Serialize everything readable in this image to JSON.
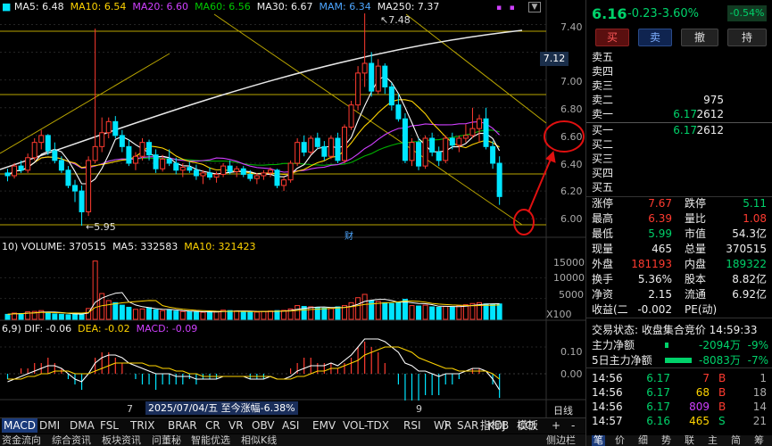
{
  "main_legend": {
    "ma5": "MA5: 6.48",
    "ma10": "MA10: 6.54",
    "ma20": "MA20: 6.60",
    "ma60": "MA60: 6.56",
    "ma30": "MA30: 6.67",
    "mam": "MAM: 6.34",
    "ma250": "MA250: 7.37"
  },
  "price_axis": [
    "7.40",
    "7.20",
    "7.00",
    "6.80",
    "6.60",
    "6.40",
    "6.20",
    "6.00"
  ],
  "current_price_tag": "7.12",
  "high_mark": "7.48",
  "low_mark": "5.95",
  "cai_tag": "财",
  "volume_legend": {
    "prefix": "10)",
    "volume": "VOLUME: 370515",
    "ma5": "MA5: 332583",
    "ma10": "MA10: 321423"
  },
  "volume_axis": [
    "15000",
    "10000",
    "5000"
  ],
  "volume_unit": "X100",
  "macd_legend": {
    "prefix": "6,9)",
    "dif": "DIF: -0.06",
    "dea": "DEA: -0.02",
    "macd": "MACD: -0.09"
  },
  "macd_axis": [
    "0.10",
    "0.00"
  ],
  "x_labels": {
    "m7": "7",
    "m9": "9",
    "date_info": "2025/07/04/五  至今涨幅-6.38%",
    "period": "日线"
  },
  "indicator_tabs": [
    "MACD",
    "DMI",
    "DMA",
    "FSL",
    "TRIX",
    "BRAR",
    "CR",
    "VR",
    "OBV",
    "ASI",
    "EMV",
    "VOL-TDX",
    "RSI",
    "WR",
    "SAR",
    "KDJ",
    "CCI"
  ],
  "indicator_right": {
    "more": "〉",
    "indicator_b": "指标B",
    "template": "模板",
    "plus": "+",
    "minus": "-"
  },
  "bottom_tabs": [
    "资金流向",
    "综合资讯",
    "板块资讯",
    "问董秘",
    "智能优选",
    "相似K线"
  ],
  "bottom_right": "侧边栏",
  "quote": {
    "price": "6.16",
    "change": "-0.23",
    "pct": "-3.60%",
    "badge": "-0.54%"
  },
  "buttons": {
    "buy": "买",
    "sell": "卖",
    "cancel": "撤",
    "hold": "持"
  },
  "book_sell": [
    {
      "label": "卖五",
      "price": "",
      "vol": ""
    },
    {
      "label": "卖四",
      "price": "",
      "vol": ""
    },
    {
      "label": "卖三",
      "price": "",
      "vol": ""
    },
    {
      "label": "卖二",
      "price": "",
      "vol": "975"
    },
    {
      "label": "卖一",
      "price": "6.17",
      "vol": "2612"
    }
  ],
  "book_buy": [
    {
      "label": "买一",
      "price": "6.17",
      "vol": "2612"
    },
    {
      "label": "买二",
      "price": "",
      "vol": ""
    },
    {
      "label": "买三",
      "price": "",
      "vol": ""
    },
    {
      "label": "买四",
      "price": "",
      "vol": ""
    },
    {
      "label": "买五",
      "price": "",
      "vol": ""
    }
  ],
  "stats": [
    {
      "l1": "涨停",
      "v1": "7.67",
      "c1": "red",
      "l2": "跌停",
      "v2": "5.11",
      "c2": "green"
    },
    {
      "l1": "最高",
      "v1": "6.39",
      "c1": "red",
      "l2": "量比",
      "v2": "1.08",
      "c2": "red"
    },
    {
      "l1": "最低",
      "v1": "5.99",
      "c1": "green",
      "l2": "市值",
      "v2": "54.3亿",
      "c2": "white"
    },
    {
      "l1": "现量",
      "v1": "465",
      "c1": "white",
      "l2": "总量",
      "v2": "370515",
      "c2": "white"
    },
    {
      "l1": "外盘",
      "v1": "181193",
      "c1": "red",
      "l2": "内盘",
      "v2": "189322",
      "c2": "green"
    },
    {
      "l1": "换手",
      "v1": "5.36%",
      "c1": "white",
      "l2": "股本",
      "v2": "8.82亿",
      "c2": "white"
    },
    {
      "l1": "净资",
      "v1": "2.15",
      "c1": "white",
      "l2": "流通",
      "v2": "6.92亿",
      "c2": "white"
    },
    {
      "l1": "收益(二",
      "v1": "-0.002",
      "c1": "white",
      "l2": "PE(动)",
      "v2": "",
      "c2": "white"
    }
  ],
  "trade_status": "交易状态: 收盘集合竞价 14:59:33",
  "flows": [
    {
      "label": "主力净额",
      "value": "-2094万",
      "pct": "-9%"
    },
    {
      "label": "5日主力净额",
      "value": "-8083万",
      "pct": "-7%"
    }
  ],
  "ticks": [
    {
      "time": "14:56",
      "price": "6.17",
      "vol": "7",
      "bs": "B",
      "n": "1",
      "vc": "red",
      "bc": "red"
    },
    {
      "time": "14:56",
      "price": "6.17",
      "vol": "68",
      "bs": "B",
      "n": "18",
      "vc": "yellow",
      "bc": "red"
    },
    {
      "time": "14:56",
      "price": "6.17",
      "vol": "809",
      "bs": "B",
      "n": "14",
      "vc": "purple",
      "bc": "red"
    },
    {
      "time": "14:57",
      "price": "6.16",
      "vol": "465",
      "bs": "S",
      "n": "21",
      "vc": "yellow",
      "bc": "green"
    }
  ],
  "right_bottom_tabs": [
    "笔",
    "价",
    "细",
    "势",
    "联",
    "主",
    "简",
    "筹"
  ],
  "colors": {
    "up": "#ff3b30",
    "down": "#00e5ff",
    "ma5": "#ffffff",
    "ma10": "#ffd400",
    "ma20": "#d040ff",
    "ma60": "#00c800",
    "annot": "#e01010"
  },
  "chart_data": {
    "type": "candlestick",
    "y_range": [
      5.93,
      7.48
    ],
    "candles": [
      [
        6.33,
        6.36,
        6.27,
        6.31
      ],
      [
        6.31,
        6.4,
        6.29,
        6.38
      ],
      [
        6.38,
        6.42,
        6.33,
        6.35
      ],
      [
        6.35,
        6.47,
        6.33,
        6.44
      ],
      [
        6.44,
        6.58,
        6.42,
        6.55
      ],
      [
        6.55,
        6.64,
        6.5,
        6.6
      ],
      [
        6.6,
        6.61,
        6.46,
        6.49
      ],
      [
        6.49,
        6.55,
        6.4,
        6.42
      ],
      [
        6.42,
        6.45,
        6.33,
        6.35
      ],
      [
        6.35,
        6.38,
        6.22,
        6.24
      ],
      [
        6.24,
        6.28,
        6.12,
        6.2
      ],
      [
        6.2,
        6.24,
        5.95,
        6.05
      ],
      [
        6.05,
        6.45,
        6.02,
        6.42
      ],
      [
        6.42,
        7.37,
        6.4,
        6.52
      ],
      [
        6.52,
        6.73,
        6.48,
        6.62
      ],
      [
        6.62,
        6.73,
        6.58,
        6.7
      ],
      [
        6.7,
        6.74,
        6.58,
        6.6
      ],
      [
        6.6,
        6.64,
        6.48,
        6.52
      ],
      [
        6.52,
        6.57,
        6.38,
        6.4
      ],
      [
        6.4,
        6.48,
        6.35,
        6.45
      ],
      [
        6.45,
        6.58,
        6.42,
        6.55
      ],
      [
        6.55,
        6.57,
        6.42,
        6.46
      ],
      [
        6.46,
        6.5,
        6.33,
        6.36
      ],
      [
        6.36,
        6.46,
        6.34,
        6.43
      ],
      [
        6.43,
        6.5,
        6.38,
        6.4
      ],
      [
        6.4,
        6.44,
        6.32,
        6.35
      ],
      [
        6.35,
        6.4,
        6.3,
        6.37
      ],
      [
        6.37,
        6.41,
        6.33,
        6.35
      ],
      [
        6.35,
        6.39,
        6.28,
        6.31
      ],
      [
        6.31,
        6.35,
        6.25,
        6.33
      ],
      [
        6.33,
        6.37,
        6.28,
        6.3
      ],
      [
        6.3,
        6.34,
        6.26,
        6.32
      ],
      [
        6.32,
        6.4,
        6.3,
        6.38
      ],
      [
        6.38,
        6.42,
        6.32,
        6.34
      ],
      [
        6.34,
        6.38,
        6.3,
        6.36
      ],
      [
        6.36,
        6.38,
        6.3,
        6.32
      ],
      [
        6.32,
        6.35,
        6.27,
        6.29
      ],
      [
        6.29,
        6.33,
        6.25,
        6.31
      ],
      [
        6.31,
        6.35,
        6.28,
        6.33
      ],
      [
        6.33,
        6.37,
        6.3,
        6.35
      ],
      [
        6.35,
        6.36,
        6.22,
        6.24
      ],
      [
        6.24,
        6.3,
        6.2,
        6.28
      ],
      [
        6.28,
        6.42,
        6.26,
        6.4
      ],
      [
        6.4,
        6.58,
        6.38,
        6.55
      ],
      [
        6.55,
        6.6,
        6.45,
        6.48
      ],
      [
        6.48,
        6.6,
        6.46,
        6.58
      ],
      [
        6.58,
        6.62,
        6.5,
        6.52
      ],
      [
        6.52,
        6.56,
        6.42,
        6.45
      ],
      [
        6.45,
        6.6,
        6.43,
        6.58
      ],
      [
        6.58,
        6.62,
        6.4,
        6.42
      ],
      [
        6.42,
        6.68,
        6.4,
        6.66
      ],
      [
        6.66,
        6.85,
        6.64,
        6.82
      ],
      [
        6.82,
        7.1,
        6.78,
        7.05
      ],
      [
        7.05,
        7.48,
        6.95,
        7.12
      ],
      [
        7.12,
        7.2,
        6.88,
        6.92
      ],
      [
        6.92,
        7.15,
        6.9,
        7.1
      ],
      [
        7.1,
        7.12,
        6.9,
        6.95
      ],
      [
        6.95,
        6.98,
        6.78,
        6.82
      ],
      [
        6.82,
        6.9,
        6.7,
        6.72
      ],
      [
        6.72,
        6.76,
        6.4,
        6.42
      ],
      [
        6.42,
        6.58,
        6.38,
        6.55
      ],
      [
        6.55,
        6.58,
        6.35,
        6.38
      ],
      [
        6.38,
        6.6,
        6.36,
        6.58
      ],
      [
        6.58,
        6.62,
        6.45,
        6.48
      ],
      [
        6.48,
        6.52,
        6.38,
        6.42
      ],
      [
        6.42,
        6.6,
        6.4,
        6.58
      ],
      [
        6.58,
        6.62,
        6.5,
        6.53
      ],
      [
        6.53,
        6.6,
        6.48,
        6.58
      ],
      [
        6.58,
        6.68,
        6.55,
        6.6
      ],
      [
        6.6,
        6.8,
        6.58,
        6.65
      ],
      [
        6.65,
        6.75,
        6.55,
        6.72
      ],
      [
        6.72,
        6.8,
        6.5,
        6.52
      ],
      [
        6.52,
        6.56,
        6.36,
        6.4
      ],
      [
        6.4,
        6.45,
        6.1,
        6.16
      ]
    ],
    "volumes": [
      120,
      150,
      140,
      180,
      190,
      210,
      160,
      130,
      120,
      110,
      130,
      140,
      260,
      1400,
      620,
      450,
      400,
      340,
      290,
      240,
      250,
      280,
      230,
      210,
      220,
      200,
      190,
      180,
      175,
      170,
      180,
      185,
      220,
      210,
      200,
      190,
      180,
      175,
      190,
      200,
      210,
      215,
      250,
      330,
      310,
      300,
      280,
      270,
      260,
      300,
      330,
      400,
      520,
      600,
      450,
      430,
      400,
      380,
      400,
      480,
      330,
      320,
      340,
      300,
      290,
      310,
      300,
      330,
      350,
      380,
      400,
      370,
      360,
      370
    ],
    "macd": [
      {
        "dif": -0.03,
        "dea": -0.02,
        "hist": -0.02
      },
      {
        "dif": -0.02,
        "dea": -0.02,
        "hist": 0.0
      },
      {
        "dif": -0.01,
        "dea": -0.02,
        "hist": 0.02
      },
      {
        "dif": 0.0,
        "dea": -0.01,
        "hist": 0.02
      },
      {
        "dif": 0.01,
        "dea": -0.01,
        "hist": 0.04
      },
      {
        "dif": 0.02,
        "dea": 0.0,
        "hist": 0.04
      },
      {
        "dif": 0.03,
        "dea": 0.0,
        "hist": 0.06
      },
      {
        "dif": 0.03,
        "dea": 0.01,
        "hist": 0.04
      },
      {
        "dif": 0.02,
        "dea": 0.01,
        "hist": 0.02
      },
      {
        "dif": 0.0,
        "dea": 0.01,
        "hist": -0.02
      },
      {
        "dif": -0.02,
        "dea": 0.0,
        "hist": -0.04
      },
      {
        "dif": -0.03,
        "dea": 0.0,
        "hist": -0.06
      },
      {
        "dif": 0.0,
        "dea": 0.0,
        "hist": 0.0
      },
      {
        "dif": 0.04,
        "dea": 0.01,
        "hist": 0.06
      },
      {
        "dif": 0.06,
        "dea": 0.02,
        "hist": 0.08
      },
      {
        "dif": 0.07,
        "dea": 0.03,
        "hist": 0.08
      },
      {
        "dif": 0.07,
        "dea": 0.04,
        "hist": 0.06
      },
      {
        "dif": 0.06,
        "dea": 0.04,
        "hist": 0.04
      },
      {
        "dif": 0.04,
        "dea": 0.04,
        "hist": 0.0
      },
      {
        "dif": 0.03,
        "dea": 0.04,
        "hist": -0.02
      },
      {
        "dif": 0.02,
        "dea": 0.04,
        "hist": -0.04
      },
      {
        "dif": 0.01,
        "dea": 0.03,
        "hist": -0.04
      },
      {
        "dif": 0.0,
        "dea": 0.03,
        "hist": -0.06
      },
      {
        "dif": 0.0,
        "dea": 0.02,
        "hist": -0.04
      },
      {
        "dif": 0.0,
        "dea": 0.02,
        "hist": -0.04
      },
      {
        "dif": -0.01,
        "dea": 0.01,
        "hist": -0.04
      },
      {
        "dif": -0.01,
        "dea": 0.01,
        "hist": -0.04
      },
      {
        "dif": -0.01,
        "dea": 0.0,
        "hist": -0.02
      },
      {
        "dif": -0.02,
        "dea": 0.0,
        "hist": -0.04
      },
      {
        "dif": -0.02,
        "dea": -0.01,
        "hist": -0.02
      },
      {
        "dif": -0.02,
        "dea": -0.01,
        "hist": -0.02
      },
      {
        "dif": -0.02,
        "dea": -0.01,
        "hist": -0.02
      },
      {
        "dif": -0.01,
        "dea": -0.01,
        "hist": 0.0
      },
      {
        "dif": -0.01,
        "dea": -0.01,
        "hist": 0.0
      },
      {
        "dif": -0.01,
        "dea": -0.01,
        "hist": 0.0
      },
      {
        "dif": -0.01,
        "dea": -0.01,
        "hist": 0.0
      },
      {
        "dif": -0.02,
        "dea": -0.01,
        "hist": -0.02
      },
      {
        "dif": -0.02,
        "dea": -0.01,
        "hist": -0.02
      },
      {
        "dif": -0.02,
        "dea": -0.01,
        "hist": -0.02
      },
      {
        "dif": -0.01,
        "dea": -0.01,
        "hist": 0.0
      },
      {
        "dif": -0.02,
        "dea": -0.02,
        "hist": 0.0
      },
      {
        "dif": -0.02,
        "dea": -0.02,
        "hist": 0.0
      },
      {
        "dif": -0.01,
        "dea": -0.02,
        "hist": 0.02
      },
      {
        "dif": 0.01,
        "dea": -0.01,
        "hist": 0.04
      },
      {
        "dif": 0.02,
        "dea": -0.01,
        "hist": 0.06
      },
      {
        "dif": 0.03,
        "dea": 0.0,
        "hist": 0.06
      },
      {
        "dif": 0.03,
        "dea": 0.01,
        "hist": 0.04
      },
      {
        "dif": 0.03,
        "dea": 0.01,
        "hist": 0.04
      },
      {
        "dif": 0.04,
        "dea": 0.02,
        "hist": 0.04
      },
      {
        "dif": 0.03,
        "dea": 0.02,
        "hist": 0.02
      },
      {
        "dif": 0.05,
        "dea": 0.03,
        "hist": 0.04
      },
      {
        "dif": 0.07,
        "dea": 0.04,
        "hist": 0.06
      },
      {
        "dif": 0.1,
        "dea": 0.05,
        "hist": 0.1
      },
      {
        "dif": 0.13,
        "dea": 0.07,
        "hist": 0.12
      },
      {
        "dif": 0.13,
        "dea": 0.08,
        "hist": 0.1
      },
      {
        "dif": 0.13,
        "dea": 0.09,
        "hist": 0.08
      },
      {
        "dif": 0.12,
        "dea": 0.1,
        "hist": 0.04
      },
      {
        "dif": 0.1,
        "dea": 0.1,
        "hist": 0.0
      },
      {
        "dif": 0.08,
        "dea": 0.1,
        "hist": -0.04
      },
      {
        "dif": 0.04,
        "dea": 0.09,
        "hist": -0.1
      },
      {
        "dif": 0.03,
        "dea": 0.08,
        "hist": -0.1
      },
      {
        "dif": 0.01,
        "dea": 0.06,
        "hist": -0.1
      },
      {
        "dif": 0.01,
        "dea": 0.05,
        "hist": -0.08
      },
      {
        "dif": 0.0,
        "dea": 0.04,
        "hist": -0.08
      },
      {
        "dif": -0.01,
        "dea": 0.03,
        "hist": -0.08
      },
      {
        "dif": 0.0,
        "dea": 0.02,
        "hist": -0.04
      },
      {
        "dif": 0.0,
        "dea": 0.02,
        "hist": -0.04
      },
      {
        "dif": 0.0,
        "dea": 0.01,
        "hist": -0.02
      },
      {
        "dif": 0.01,
        "dea": 0.01,
        "hist": 0.0
      },
      {
        "dif": 0.02,
        "dea": 0.01,
        "hist": 0.02
      },
      {
        "dif": 0.02,
        "dea": 0.01,
        "hist": 0.02
      },
      {
        "dif": 0.01,
        "dea": 0.01,
        "hist": 0.0
      },
      {
        "dif": -0.02,
        "dea": 0.0,
        "hist": -0.04
      },
      {
        "dif": -0.06,
        "dea": -0.02,
        "hist": -0.09
      }
    ]
  }
}
